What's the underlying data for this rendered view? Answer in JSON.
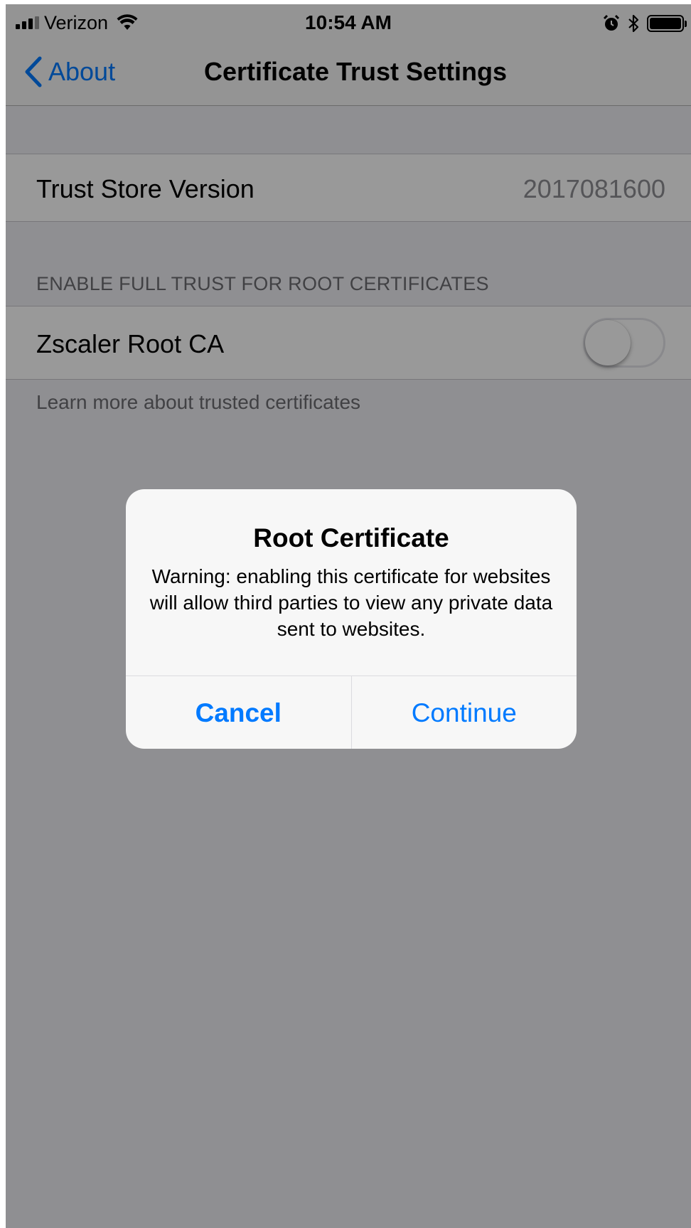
{
  "status_bar": {
    "carrier": "Verizon",
    "time": "10:54 AM",
    "battery_level": 1.0,
    "icons": [
      "signal-icon",
      "wifi-icon",
      "alarm-icon",
      "bluetooth-icon",
      "battery-icon"
    ]
  },
  "nav": {
    "back_label": "About",
    "title": "Certificate Trust Settings"
  },
  "trust_store": {
    "label": "Trust Store Version",
    "value": "2017081600"
  },
  "root_certs": {
    "section_header": "ENABLE FULL TRUST FOR ROOT CERTIFICATES",
    "items": [
      {
        "label": "Zscaler Root CA",
        "enabled": false
      }
    ],
    "footer_link": "Learn more about trusted certificates"
  },
  "alert": {
    "title": "Root Certificate",
    "message": "Warning: enabling this certificate for websites will allow third parties to view any private data sent to websites.",
    "cancel_label": "Cancel",
    "continue_label": "Continue"
  },
  "colors": {
    "accent": "#007aff",
    "background": "#efeff4",
    "secondary_text": "#8e8e93"
  }
}
